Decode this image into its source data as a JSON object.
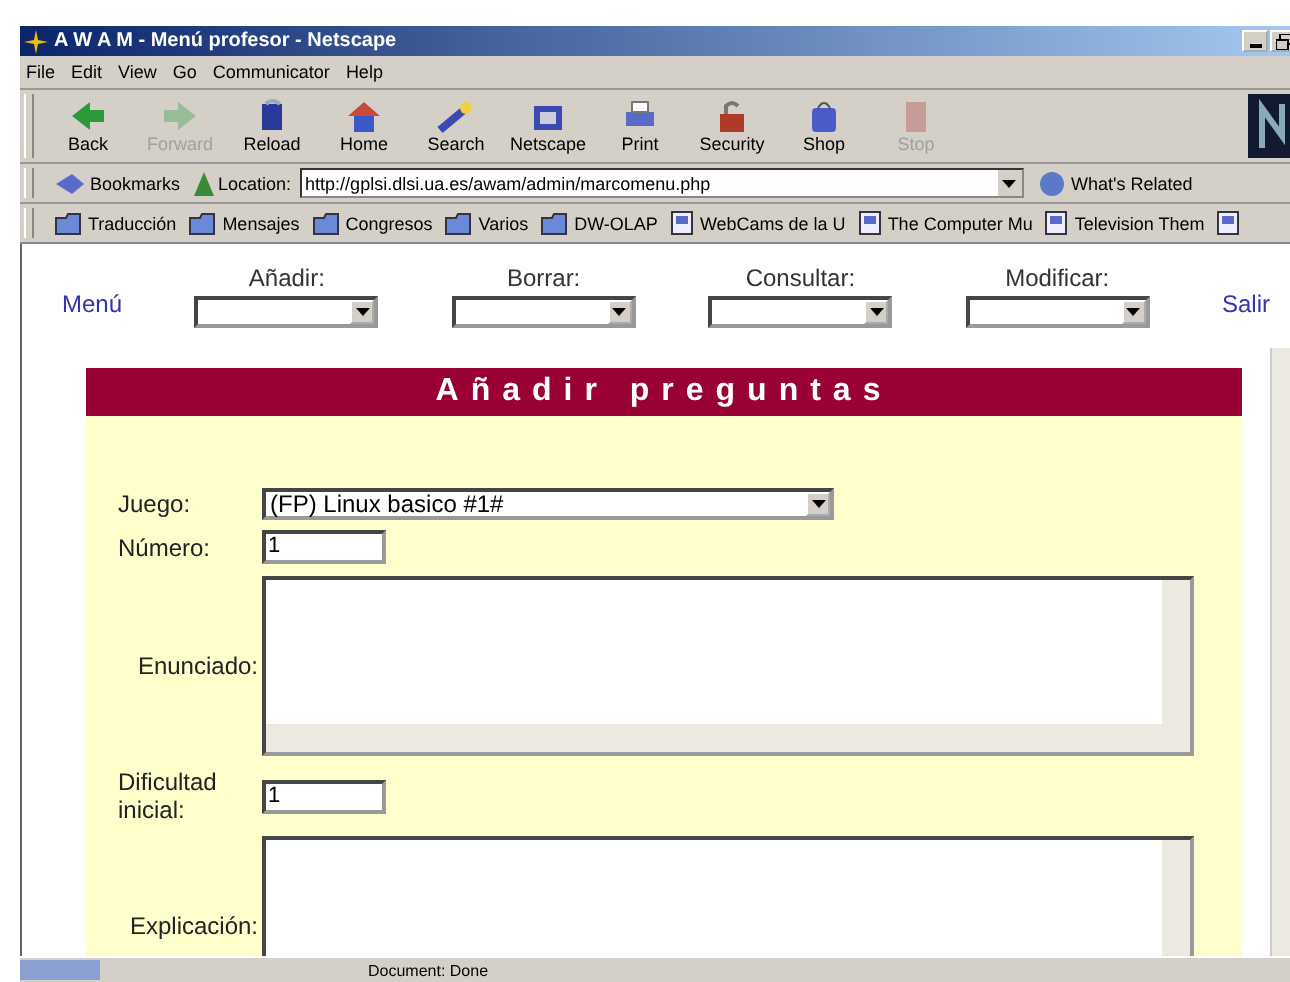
{
  "window": {
    "title": "A W A M - Menú profesor - Netscape"
  },
  "menu": [
    "File",
    "Edit",
    "View",
    "Go",
    "Communicator",
    "Help"
  ],
  "toolbar": [
    {
      "label": "Back",
      "kind": "back",
      "disabled": false
    },
    {
      "label": "Forward",
      "kind": "forward",
      "disabled": true
    },
    {
      "label": "Reload",
      "kind": "reload",
      "disabled": false
    },
    {
      "label": "Home",
      "kind": "home",
      "disabled": false
    },
    {
      "label": "Search",
      "kind": "search",
      "disabled": false
    },
    {
      "label": "Netscape",
      "kind": "netscape",
      "disabled": false
    },
    {
      "label": "Print",
      "kind": "print",
      "disabled": false
    },
    {
      "label": "Security",
      "kind": "security",
      "disabled": false
    },
    {
      "label": "Shop",
      "kind": "shop",
      "disabled": false
    },
    {
      "label": "Stop",
      "kind": "stop",
      "disabled": true
    }
  ],
  "location": {
    "bookmarks": "Bookmarks",
    "label": "Location:",
    "url": "http://gplsi.dlsi.ua.es/awam/admin/marcomenu.php",
    "related": "What's Related"
  },
  "personal_toolbar": [
    {
      "label": "Traducción",
      "kind": "folder"
    },
    {
      "label": "Mensajes",
      "kind": "folder"
    },
    {
      "label": "Congresos",
      "kind": "folder"
    },
    {
      "label": "Varios",
      "kind": "folder"
    },
    {
      "label": "DW-OLAP",
      "kind": "folder"
    },
    {
      "label": "WebCams de la U",
      "kind": "page"
    },
    {
      "label": "The Computer Mu",
      "kind": "page"
    },
    {
      "label": "Television Them",
      "kind": "page"
    }
  ],
  "nav": {
    "left_link": "Menú",
    "selects": [
      {
        "label": "Añadir:"
      },
      {
        "label": "Borrar:"
      },
      {
        "label": "Consultar:"
      },
      {
        "label": "Modificar:"
      }
    ],
    "right_link": "Salir"
  },
  "form": {
    "title": "Añadir preguntas",
    "fields": [
      {
        "label": "Juego:",
        "kind": "select",
        "value": "(FP) Linux basico #1#"
      },
      {
        "label": "Número:",
        "kind": "input",
        "value": "1"
      },
      {
        "label": "Enunciado:",
        "kind": "textarea"
      },
      {
        "label": "Dificultad inicial:",
        "kind": "input",
        "value": "1"
      },
      {
        "label": "Explicación:",
        "kind": "textarea"
      }
    ]
  },
  "status_bar": {
    "text": "Document: Done"
  }
}
